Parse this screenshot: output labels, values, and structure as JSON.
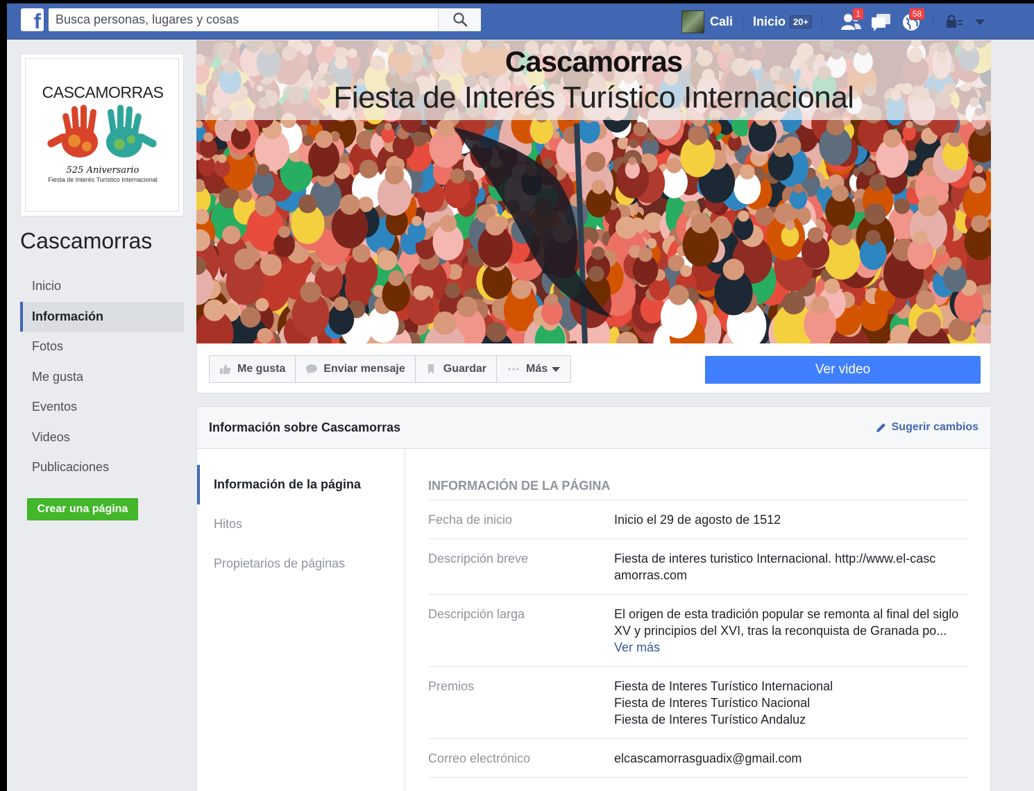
{
  "topbar": {
    "search_placeholder": "Busca personas, lugares y cosas",
    "user_name": "Cali",
    "home_label": "Inicio",
    "home_count": "20+",
    "friend_requests_badge": "1",
    "notifications_badge": "58"
  },
  "sidebar": {
    "logo_title": "CASCAMORRAS",
    "logo_anniversary": "525 Aniversario",
    "logo_subtitle": "Fiesta de Interés Turístico Internacional",
    "page_name": "Cascamorras",
    "items": [
      {
        "label": "Inicio"
      },
      {
        "label": "Información"
      },
      {
        "label": "Fotos"
      },
      {
        "label": "Me gusta"
      },
      {
        "label": "Eventos"
      },
      {
        "label": "Videos"
      },
      {
        "label": "Publicaciones"
      }
    ],
    "active_item": "Información",
    "create_page_label": "Crear una página"
  },
  "cover": {
    "title": "Cascamorras",
    "subtitle": "Fiesta de Interés Turístico Internacional"
  },
  "actions": {
    "like": "Me gusta",
    "message": "Enviar mensaje",
    "save": "Guardar",
    "more": "Más",
    "video": "Ver video"
  },
  "about": {
    "title": "Información sobre Cascamorras",
    "suggest": "Sugerir cambios",
    "subnav": [
      {
        "label": "Información de la página"
      },
      {
        "label": "Hitos"
      },
      {
        "label": "Propietarios de páginas"
      }
    ],
    "section_heading": "INFORMACIÓN DE LA PÁGINA",
    "rows": {
      "start": {
        "label": "Fecha de inicio",
        "value": "Inicio el 29 de agosto de 1512"
      },
      "short": {
        "label": "Descripción breve",
        "value": "Fiesta de interes turistico Internacional. http://www.el-cascamorras.com"
      },
      "long": {
        "label": "Descripción larga",
        "value": "El origen de esta tradición popular se remonta al final del siglo XV y principios del XVI, tras la reconquista de Granada po...",
        "more": "Ver más"
      },
      "awards": {
        "label": "Premios",
        "values": [
          "Fiesta de Interes Turístico Internacional",
          "Fiesta de Interes Turístico Nacional",
          "Fiesta de Interes Turístico Andaluz"
        ]
      },
      "email": {
        "label": "Correo electrónico",
        "value": "elcascamorrasguadix@gmail.com"
      }
    }
  },
  "colors": {
    "brand_blue": "#4267b2",
    "button_blue": "#4080ff",
    "create_green": "#42b72a",
    "badge_red": "#fa3e3e"
  },
  "icons": [
    "facebook-logo-icon",
    "search-icon",
    "friend-requests-icon",
    "messages-icon",
    "notifications-globe-icon",
    "privacy-lock-icon",
    "dropdown-caret-icon",
    "like-icon",
    "message-bubble-icon",
    "bookmark-icon",
    "more-dots-icon",
    "pencil-icon"
  ]
}
